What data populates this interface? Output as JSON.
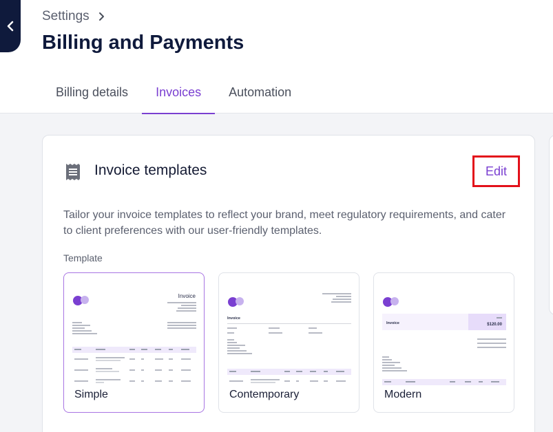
{
  "header": {
    "breadcrumb": "Settings",
    "title": "Billing and Payments"
  },
  "tabs": [
    {
      "label": "Billing details",
      "active": false
    },
    {
      "label": "Invoices",
      "active": true
    },
    {
      "label": "Automation",
      "active": false
    }
  ],
  "card": {
    "title": "Invoice templates",
    "edit_label": "Edit",
    "description": "Tailor your invoice templates to reflect your brand, meet regulatory requirements, and cater to client preferences with our user-friendly templates.",
    "template_label": "Template",
    "templates": [
      {
        "name": "Simple",
        "selected": true,
        "heading": "Invoice"
      },
      {
        "name": "Contemporary",
        "selected": false,
        "heading": "Invoice"
      },
      {
        "name": "Modern",
        "selected": false,
        "heading": "Invoice",
        "total": "$120.00"
      }
    ]
  },
  "colors": {
    "accent": "#7a3fd1",
    "navy": "#0f1a3c",
    "highlight": "#e3101a"
  }
}
